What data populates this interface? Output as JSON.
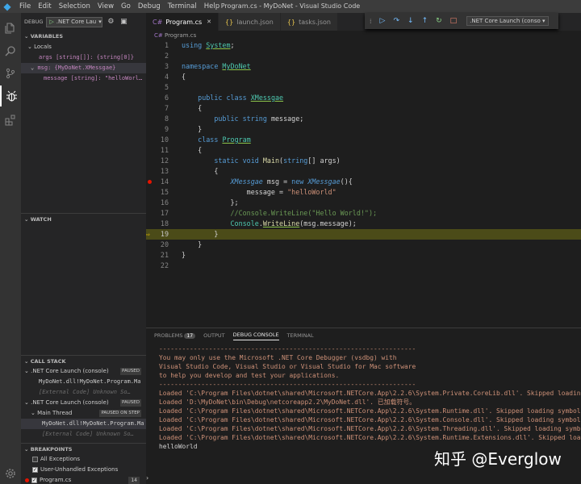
{
  "window": {
    "title": "Program.cs - MyDoNet - Visual Studio Code",
    "logo": "vscode-logo",
    "controls": [
      "—",
      "❐",
      "✕"
    ]
  },
  "menu": [
    "File",
    "Edit",
    "Selection",
    "View",
    "Go",
    "Debug",
    "Terminal",
    "Help"
  ],
  "activity": [
    "explorer-icon",
    "search-icon",
    "source-control-icon",
    "debug-icon",
    "extensions-icon",
    "settings-gear-icon"
  ],
  "debug_bar": {
    "label": "DEBUG",
    "config": ".NET Core Lau"
  },
  "variables": {
    "header": "VARIABLES",
    "locals": "Locals",
    "args": "args [string[]]: {string[0]}",
    "msg": "msg: {MyDoNet.XMessgae}",
    "message": "message [string]: \"helloWorl…"
  },
  "watch": {
    "header": "WATCH"
  },
  "callstack": {
    "header": "CALL STACK",
    "rows": [
      {
        "text": ".NET Core Launch (console)",
        "badge": "PAUSED"
      },
      {
        "text": "MyDoNet.dll!MyDoNet.Program.Ma"
      },
      {
        "text": "[External Code]   Unknown So…"
      },
      {
        "text": ".NET Core Launch (console)",
        "badge": "PAUSED"
      },
      {
        "text": "Main Thread",
        "badge": "PAUSED ON STEP"
      },
      {
        "text": "MyDoNet.dll!MyDoNet.Program.Ma"
      },
      {
        "text": "[External Code]   Unknown So…"
      }
    ]
  },
  "breakpoints": {
    "header": "BREAKPOINTS",
    "items": [
      {
        "label": "All Exceptions",
        "checked": false
      },
      {
        "label": "User-Unhandled Exceptions",
        "checked": true
      },
      {
        "label": "Program.cs",
        "checked": true,
        "count": "14"
      }
    ]
  },
  "tabs": [
    {
      "label": "Program.cs",
      "icon": "C#",
      "active": true
    },
    {
      "label": "launch.json",
      "icon": "{}",
      "active": false
    },
    {
      "label": "tasks.json",
      "icon": "{}",
      "active": false
    }
  ],
  "debug_toolbar": {
    "config": ".NET Core Launch (conso"
  },
  "breadcrumb": "Program.cs",
  "code": {
    "current_line": 19,
    "breakpoint_line": 14
  },
  "panel": {
    "tabs": [
      {
        "label": "PROBLEMS",
        "badge": "17"
      },
      {
        "label": "OUTPUT"
      },
      {
        "label": "DEBUG CONSOLE",
        "active": true
      },
      {
        "label": "TERMINAL"
      }
    ],
    "lines": [
      "-------------------------------------------------------------------",
      "You may only use the Microsoft .NET Core Debugger (vsdbg) with",
      "Visual Studio Code, Visual Studio or Visual Studio for Mac software",
      "to help you develop and test your applications.",
      "-------------------------------------------------------------------",
      "Loaded 'C:\\Program Files\\dotnet\\shared\\Microsoft.NETCore.App\\2.2.6\\System.Private.CoreLib.dll'. Skipped loading sym",
      "Loaded 'D:\\MyDoNet\\bin\\Debug\\netcoreapp2.2\\MyDoNet.dll'. 已加载符号。",
      "Loaded 'C:\\Program Files\\dotnet\\shared\\Microsoft.NETCore.App\\2.2.6\\System.Runtime.dll'. Skipped loading symbols. Mo",
      "Loaded 'C:\\Program Files\\dotnet\\shared\\Microsoft.NETCore.App\\2.2.6\\System.Console.dll'. Skipped loading symbols. Mo",
      "Loaded 'C:\\Program Files\\dotnet\\shared\\Microsoft.NETCore.App\\2.2.6\\System.Threading.dll'. Skipped loading symbols.",
      "Loaded 'C:\\Program Files\\dotnet\\shared\\Microsoft.NETCore.App\\2.2.6\\System.Runtime.Extensions.dll'. Skipped loading"
    ],
    "final": "helloWorld"
  },
  "watermark": "知乎 @Everglow",
  "bottom_prompt": "›"
}
